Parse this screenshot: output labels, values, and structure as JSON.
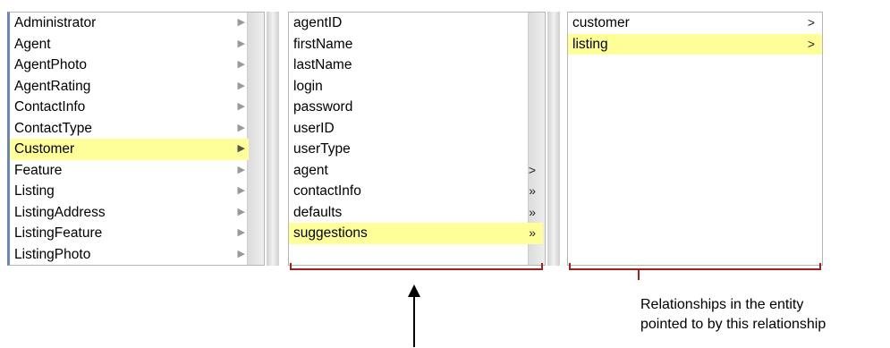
{
  "entities": {
    "items": [
      {
        "label": "Administrator",
        "arrow": "▶"
      },
      {
        "label": "Agent",
        "arrow": "▶"
      },
      {
        "label": "AgentPhoto",
        "arrow": "▶"
      },
      {
        "label": "AgentRating",
        "arrow": "▶"
      },
      {
        "label": "ContactInfo",
        "arrow": "▶"
      },
      {
        "label": "ContactType",
        "arrow": "▶"
      },
      {
        "label": "Customer",
        "arrow": "▶"
      },
      {
        "label": "Feature",
        "arrow": "▶"
      },
      {
        "label": "Listing",
        "arrow": "▶"
      },
      {
        "label": "ListingAddress",
        "arrow": "▶"
      },
      {
        "label": "ListingFeature",
        "arrow": "▶"
      },
      {
        "label": "ListingPhoto",
        "arrow": "▶"
      }
    ],
    "selected": "Customer"
  },
  "properties": {
    "items": [
      {
        "label": "agentID",
        "arrow": ""
      },
      {
        "label": "firstName",
        "arrow": ""
      },
      {
        "label": "lastName",
        "arrow": ""
      },
      {
        "label": "login",
        "arrow": ""
      },
      {
        "label": "password",
        "arrow": ""
      },
      {
        "label": "userID",
        "arrow": ""
      },
      {
        "label": "userType",
        "arrow": ""
      },
      {
        "label": "agent",
        "arrow": ">"
      },
      {
        "label": "contactInfo",
        "arrow": "»"
      },
      {
        "label": "defaults",
        "arrow": "»"
      },
      {
        "label": "suggestions",
        "arrow": "»"
      }
    ],
    "selected": "suggestions"
  },
  "relationships": {
    "items": [
      {
        "label": "customer",
        "arrow": ">"
      },
      {
        "label": "listing",
        "arrow": ">"
      }
    ],
    "selected": "listing"
  },
  "caption": {
    "line1": "Relationships in the entity",
    "line2": "pointed to by this relationship"
  },
  "colors": {
    "selection": "#ffff99",
    "bracket": "#a02020",
    "focus_border": "#6a87b8"
  }
}
